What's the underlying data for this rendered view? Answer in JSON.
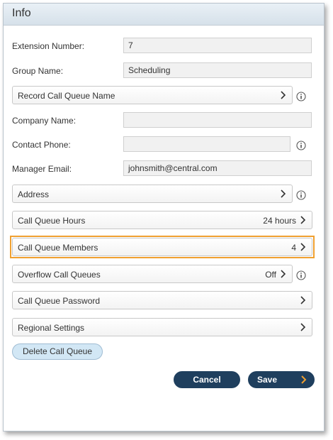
{
  "header": {
    "title": "Info"
  },
  "fields": {
    "extension": {
      "label": "Extension Number:",
      "value": "7"
    },
    "group_name": {
      "label": "Group Name:",
      "value": "Scheduling"
    },
    "company_name": {
      "label": "Company Name:",
      "value": ""
    },
    "contact_phone": {
      "label": "Contact Phone:",
      "value": ""
    },
    "manager_email": {
      "label": "Manager Email:",
      "value": "johnsmith@central.com"
    }
  },
  "rows": {
    "record_name": {
      "label": "Record Call Queue Name"
    },
    "address": {
      "label": "Address"
    },
    "hours": {
      "label": "Call Queue Hours",
      "value": "24 hours"
    },
    "members": {
      "label": "Call Queue Members",
      "value": "4"
    },
    "overflow": {
      "label": "Overflow Call Queues",
      "value": "Off"
    },
    "password": {
      "label": "Call Queue Password"
    },
    "regional": {
      "label": "Regional Settings"
    }
  },
  "actions": {
    "delete_label": "Delete Call Queue",
    "cancel_label": "Cancel",
    "save_label": "Save"
  },
  "icons": {
    "chevron": "chevron-right-icon",
    "info": "info-icon",
    "save_arrow": "chevron-right-icon"
  },
  "colors": {
    "highlight": "#f0a030",
    "primary_button": "#1f3f5e",
    "save_arrow": "#f0a030",
    "delete_button": "#d2e7f5"
  }
}
